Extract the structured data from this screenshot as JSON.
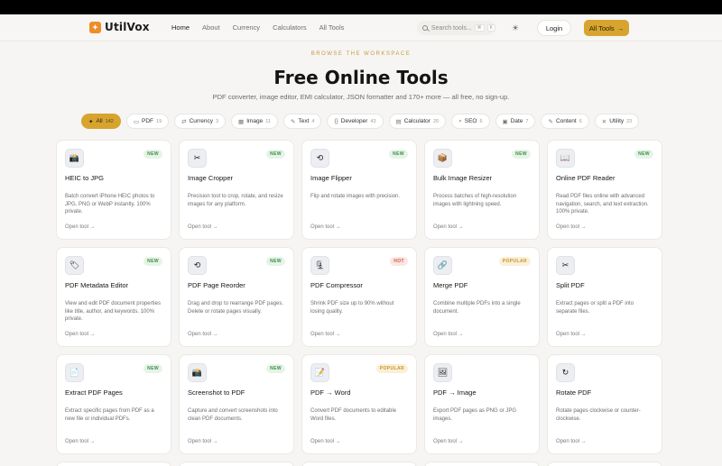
{
  "brand": {
    "name": "UtilVox",
    "accent": "#d7a42f",
    "logo_color": "#f08c28"
  },
  "nav": {
    "links": [
      {
        "label": "Home"
      },
      {
        "label": "About"
      },
      {
        "label": "Currency"
      },
      {
        "label": "Calculators"
      },
      {
        "label": "All Tools"
      }
    ],
    "search_placeholder": "Search tools...",
    "kbd_1": "⌘",
    "kbd_2": "K",
    "theme_icon": "sun-icon",
    "login_label": "Login",
    "all_tools_label": "All Tools",
    "all_tools_arrow": "→"
  },
  "hero": {
    "eyebrow": "BROWSE THE WORKSPACE",
    "title": "Free Online Tools",
    "subtitle": "PDF converter, image editor, EMI calculator, JSON formatter and 170+ more — all free, no sign-up."
  },
  "filters": [
    {
      "icon": "✦",
      "label": "All",
      "count": "142"
    },
    {
      "icon": "▭",
      "label": "PDF",
      "count": "19"
    },
    {
      "icon": "⇄",
      "label": "Currency",
      "count": "3"
    },
    {
      "icon": "▦",
      "label": "Image",
      "count": "11"
    },
    {
      "icon": "✎",
      "label": "Text",
      "count": "4"
    },
    {
      "icon": "{}",
      "label": "Developer",
      "count": "43"
    },
    {
      "icon": "▤",
      "label": "Calculator",
      "count": "20"
    },
    {
      "icon": "⌕",
      "label": "SEO",
      "count": "6"
    },
    {
      "icon": "▣",
      "label": "Date",
      "count": "7"
    },
    {
      "icon": "✎",
      "label": "Content",
      "count": "6"
    },
    {
      "icon": "✕",
      "label": "Utility",
      "count": "23"
    }
  ],
  "cards": [
    {
      "icon": "📸",
      "badge": "NEW",
      "badge_type": "new",
      "title": "HEIC to JPG",
      "desc": "Batch convert iPhone HEIC photos to JPG, PNG or WebP instantly. 100% private.",
      "link": "Open tool →"
    },
    {
      "icon": "✂",
      "badge": "NEW",
      "badge_type": "new",
      "title": "Image Cropper",
      "desc": "Precision tool to crop, rotate, and resize images for any platform.",
      "link": "Open tool →"
    },
    {
      "icon": "⟲",
      "badge": "NEW",
      "badge_type": "new",
      "title": "Image Flipper",
      "desc": "Flip and rotate images with precision.",
      "link": "Open tool →"
    },
    {
      "icon": "📦",
      "badge": "NEW",
      "badge_type": "new",
      "title": "Bulk Image Resizer",
      "desc": "Process batches of high-resolution images with lightning speed.",
      "link": "Open tool →"
    },
    {
      "icon": "📖",
      "badge": "NEW",
      "badge_type": "new",
      "title": "Online PDF Reader",
      "desc": "Read PDF files online with advanced navigation, search, and text extraction. 100% private.",
      "link": "Open tool →"
    },
    {
      "icon": "🏷",
      "badge": "NEW",
      "badge_type": "new",
      "title": "PDF Metadata Editor",
      "desc": "View and edit PDF document properties like title, author, and keywords. 100% private.",
      "link": "Open tool →"
    },
    {
      "icon": "⟲",
      "badge": "NEW",
      "badge_type": "new",
      "title": "PDF Page Reorder",
      "desc": "Drag and drop to rearrange PDF pages. Delete or rotate pages visually.",
      "link": "Open tool →"
    },
    {
      "icon": "🗜",
      "badge": "HOT",
      "badge_type": "hot",
      "title": "PDF Compressor",
      "desc": "Shrink PDF size up to 90% without losing quality.",
      "link": "Open tool →"
    },
    {
      "icon": "🔗",
      "badge": "POPULAR",
      "badge_type": "popular",
      "title": "Merge PDF",
      "desc": "Combine multiple PDFs into a single document.",
      "link": "Open tool →"
    },
    {
      "icon": "✂",
      "badge": "",
      "badge_type": "",
      "title": "Split PDF",
      "desc": "Extract pages or split a PDF into separate files.",
      "link": "Open tool →"
    },
    {
      "icon": "📄",
      "badge": "NEW",
      "badge_type": "new",
      "title": "Extract PDF Pages",
      "desc": "Extract specific pages from PDF as a new file or individual PDFs.",
      "link": "Open tool →"
    },
    {
      "icon": "📸",
      "badge": "NEW",
      "badge_type": "new",
      "title": "Screenshot to PDF",
      "desc": "Capture and convert screenshots into clean PDF documents.",
      "link": "Open tool →"
    },
    {
      "icon": "📝",
      "badge": "POPULAR",
      "badge_type": "popular",
      "title": "PDF → Word",
      "desc": "Convert PDF documents to editable Word files.",
      "link": "Open tool →"
    },
    {
      "icon": "🖼",
      "badge": "",
      "badge_type": "",
      "title": "PDF → Image",
      "desc": "Export PDF pages as PNG or JPG images.",
      "link": "Open tool →"
    },
    {
      "icon": "↻",
      "badge": "",
      "badge_type": "",
      "title": "Rotate PDF",
      "desc": "Rotate pages clockwise or counter-clockwise.",
      "link": "Open tool →"
    }
  ]
}
